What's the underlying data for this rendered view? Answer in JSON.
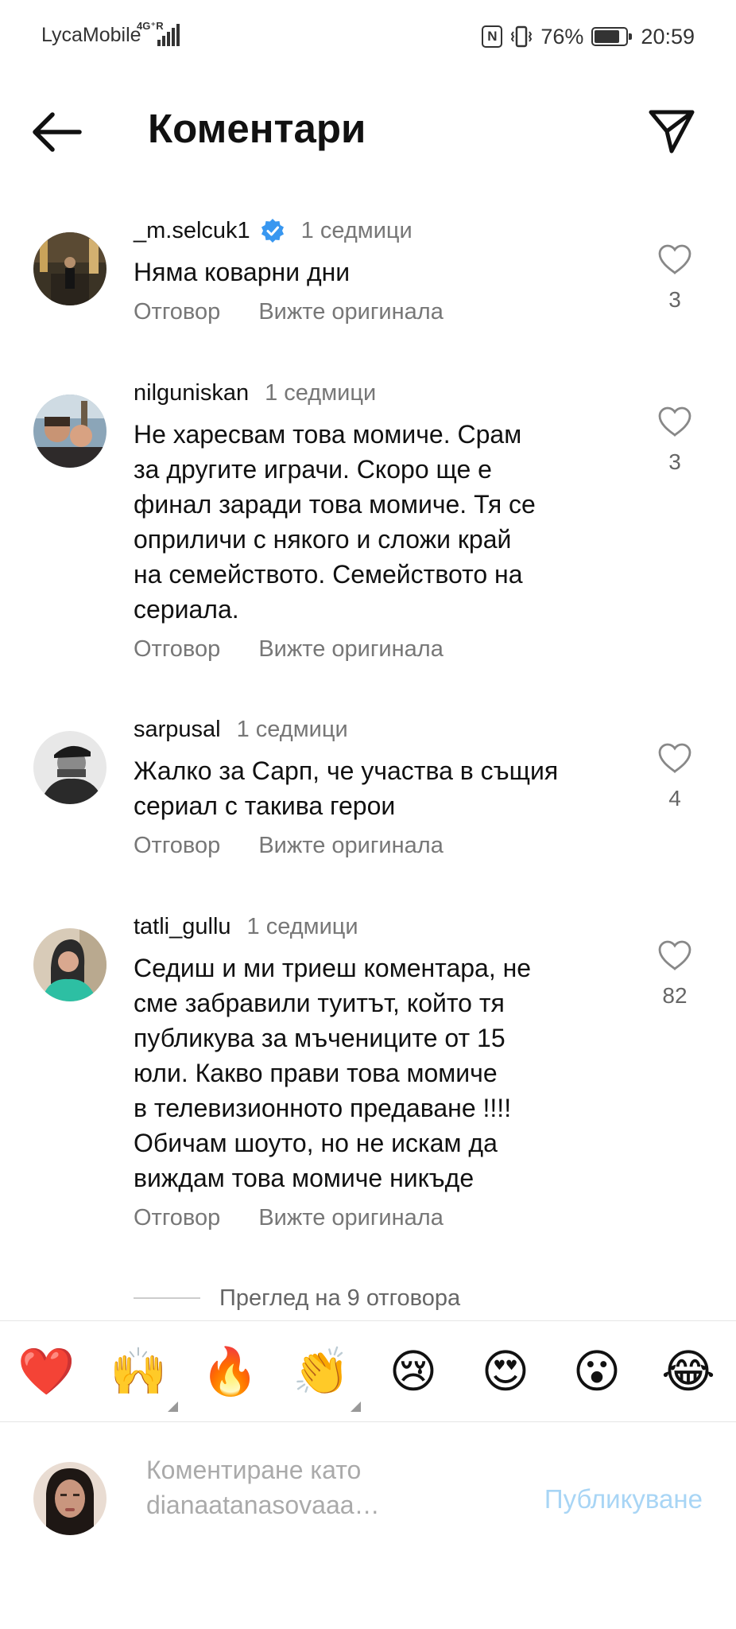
{
  "status_bar": {
    "carrier": "LycaMobile",
    "network": "4G⁺R",
    "nfc": "N",
    "battery": "76%",
    "time": "20:59"
  },
  "header": {
    "title": "Коментари",
    "back_icon": "arrow-left-icon",
    "send_icon": "paper-plane-icon"
  },
  "comments": [
    {
      "username": "_m.selcuk1",
      "verified": true,
      "time": "1 седмици",
      "text": "Няма коварни дни",
      "reply": "Отговор",
      "see_original": "Вижте оригинала",
      "likes": "3"
    },
    {
      "username": "nilguniskan",
      "verified": false,
      "time": "1 седмици",
      "text_lines": [
        "Не харесвам това момиче. Срам",
        "за другите играчи. Скоро ще е",
        "финал заради това момиче. Тя се",
        "оприличи с някого и сложи край",
        "на семейството. Семейството на",
        "сериала."
      ],
      "reply": "Отговор",
      "see_original": "Вижте оригинала",
      "likes": "3"
    },
    {
      "username": "sarpusal",
      "verified": false,
      "time": "1 седмици",
      "text_lines": [
        "Жалко за Сарп, че участва в същия",
        "сериал с такива герои"
      ],
      "reply": "Отговор",
      "see_original": "Вижте оригинала",
      "likes": "4"
    },
    {
      "username": "tatli_gullu",
      "verified": false,
      "time": "1 седмици",
      "text_lines": [
        "Седиш и ми триеш коментара, не",
        "сме забравили туитът, който тя",
        "публикува за мъчениците от 15",
        "юли. Какво прави това момиче",
        "в телевизионното предаване !!!!",
        "Обичам шоуто, но не искам да",
        "виждам това момиче никъде"
      ],
      "reply": "Отговор",
      "see_original": "Вижте оригинала",
      "likes": "82"
    }
  ],
  "view_replies": "Преглед на 9 отговора",
  "emoji_bar": [
    "❤️",
    "🙌",
    "🔥",
    "👏",
    "😢",
    "😍",
    "😮",
    "😂"
  ],
  "input": {
    "placeholder_line1": "Коментиране като",
    "placeholder_line2": "dianaatanasovaaa…",
    "post_label": "Публикуване"
  },
  "colors": {
    "verified": "#3897f0",
    "post_button": "#a8d5f5",
    "secondary_text": "#777777"
  }
}
